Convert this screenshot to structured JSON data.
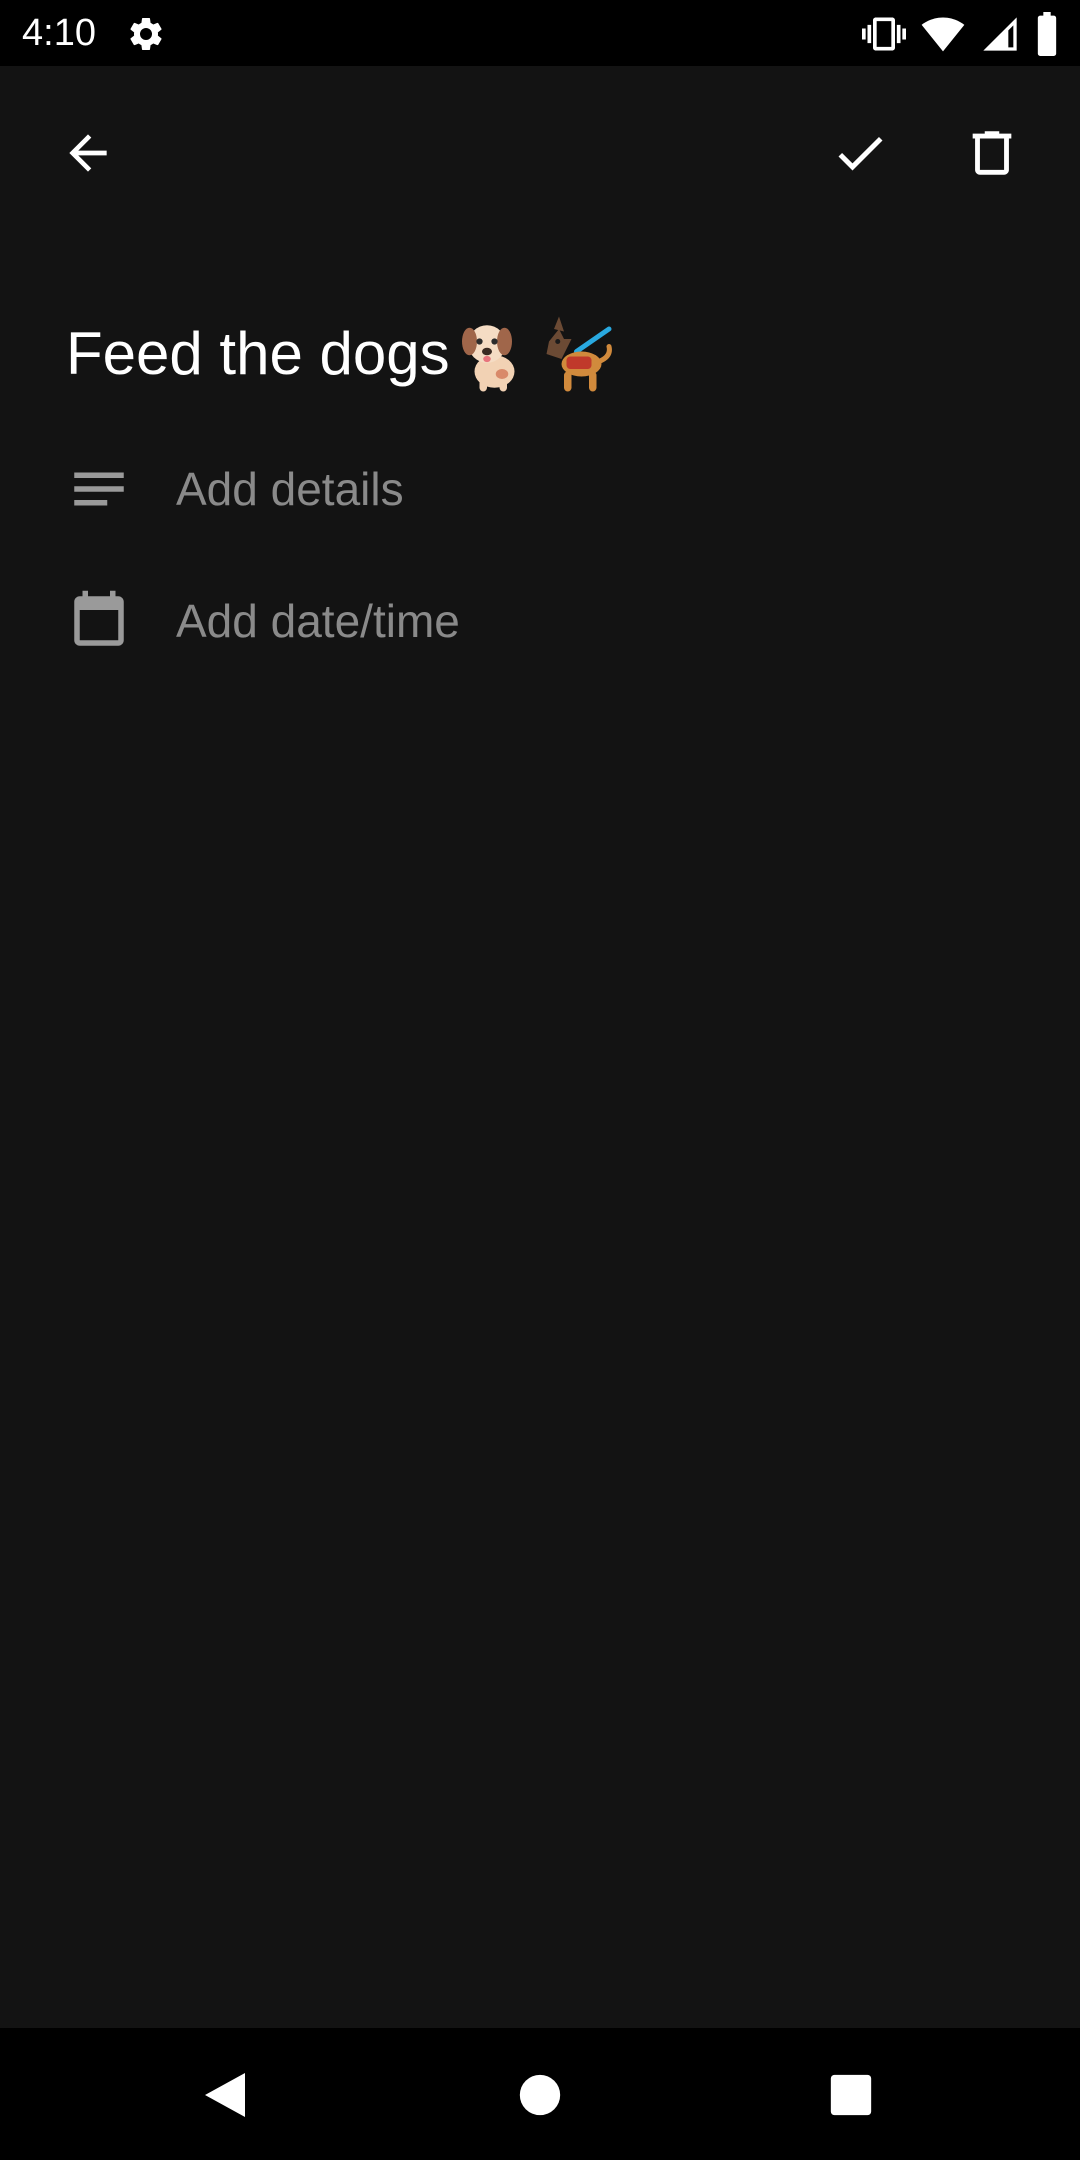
{
  "status_bar": {
    "time": "4:10",
    "icons": [
      "settings-gear-icon",
      "vibrate-icon",
      "wifi-icon",
      "cell-signal-icon",
      "battery-icon"
    ]
  },
  "toolbar": {
    "back_icon": "arrow-back-icon",
    "done_icon": "check-icon",
    "delete_icon": "trash-icon"
  },
  "task": {
    "title": "Feed the dogs",
    "title_emojis": [
      "dog-emoji",
      "service-dog-emoji"
    ]
  },
  "fields": {
    "details": {
      "icon": "notes-lines-icon",
      "placeholder": "Add details"
    },
    "date_time": {
      "icon": "calendar-icon",
      "placeholder": "Add date/time"
    }
  },
  "nav_bar": {
    "icons": [
      "nav-back-icon",
      "nav-home-icon",
      "nav-recents-icon"
    ]
  },
  "colors": {
    "background": "#131313",
    "system_bars": "#000000",
    "text_primary": "#ffffff",
    "text_placeholder": "#8a8a8a",
    "icon_secondary": "#9a9a9a"
  }
}
